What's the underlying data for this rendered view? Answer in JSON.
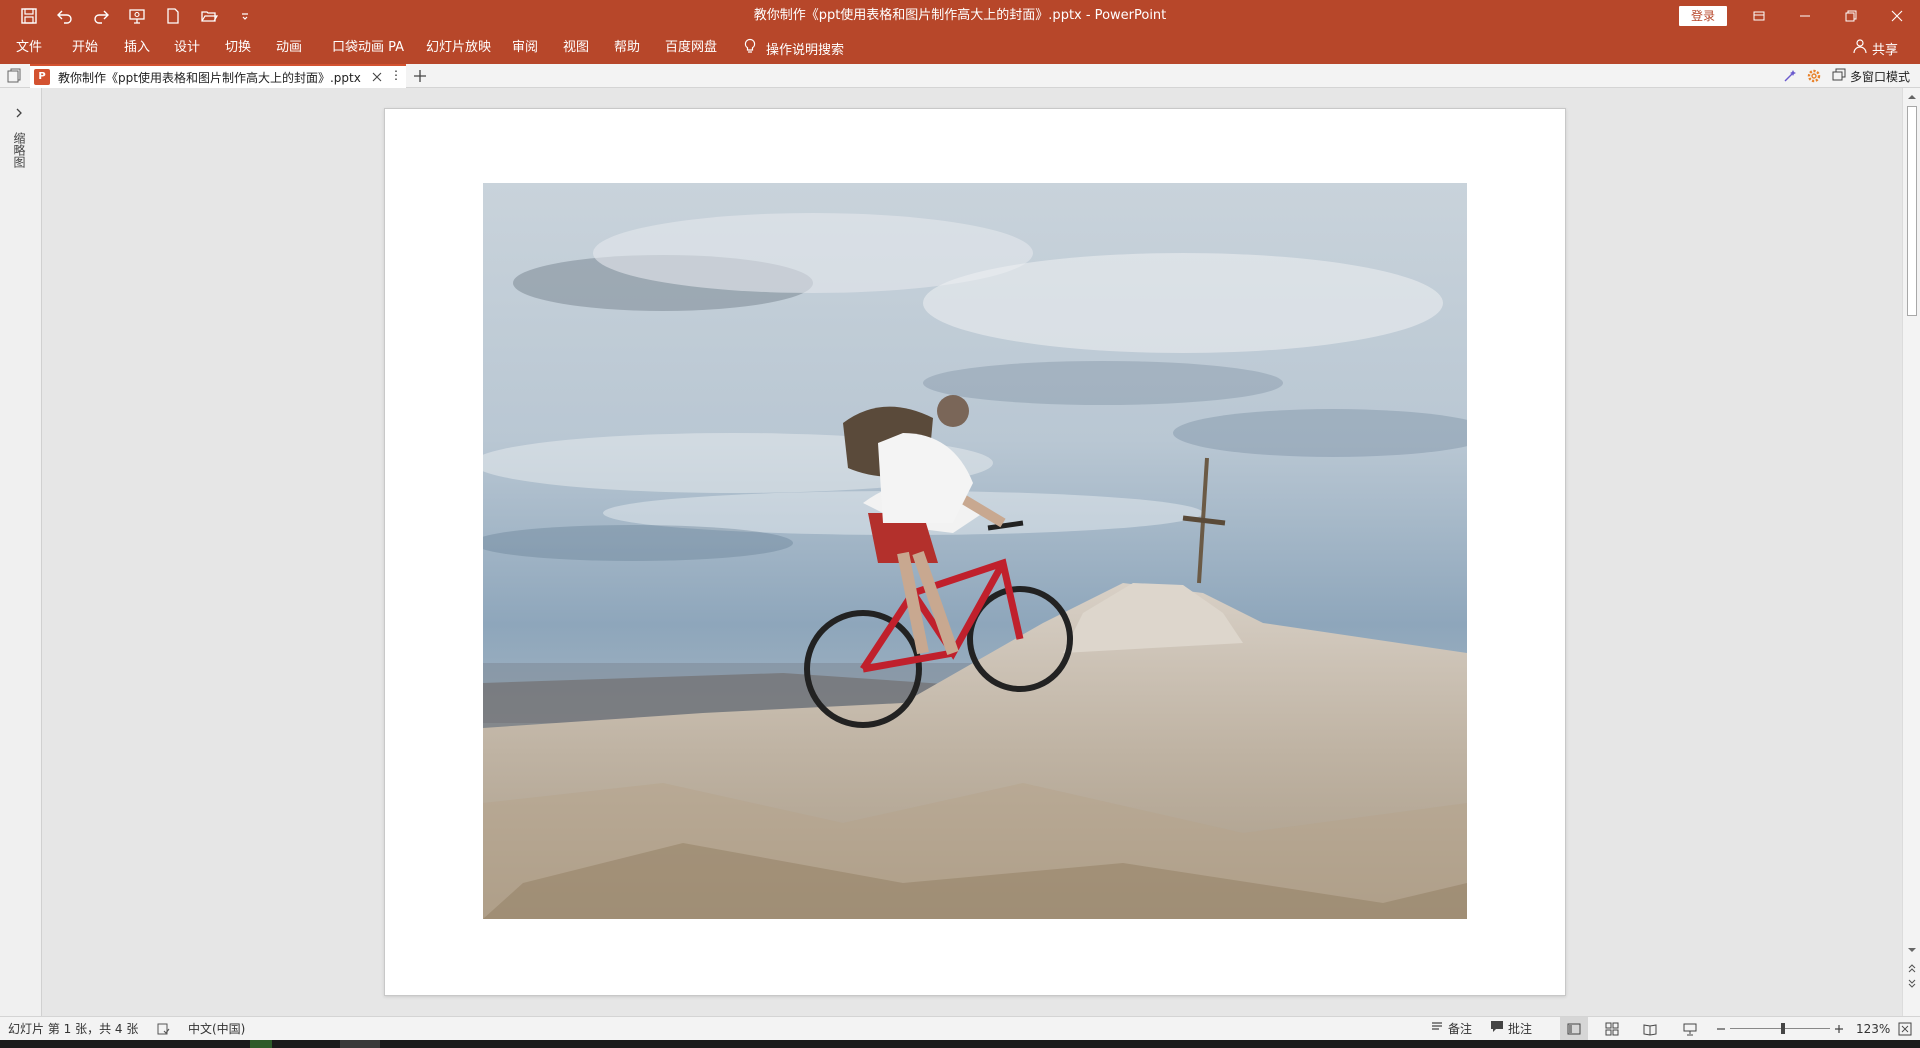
{
  "window": {
    "title": "教你制作《ppt使用表格和图片制作高大上的封面》.pptx  -  PowerPoint",
    "login_label": "登录",
    "accent_color": "#b7472a"
  },
  "quick_access": [
    "save-icon",
    "undo-icon",
    "redo-icon",
    "slideshow-from-start-icon",
    "new-file-icon",
    "open-folder-icon",
    "customize-qat-icon"
  ],
  "ribbon": {
    "tabs": [
      "文件",
      "开始",
      "插入",
      "设计",
      "切换",
      "动画",
      "口袋动画 PA",
      "幻灯片放映",
      "审阅",
      "视图",
      "帮助",
      "百度网盘"
    ],
    "tell_me": "操作说明搜索",
    "share": "共享"
  },
  "document_tab": {
    "name": "教你制作《ppt使用表格和图片制作高大上的封面》.pptx",
    "file_type_badge": "P",
    "multi_window_label": "多窗口模式"
  },
  "left_pane": {
    "label": "缩略图"
  },
  "slide": {
    "image_description_icon": "mountain-cyclist-photo"
  },
  "status_bar": {
    "slide_info": "幻灯片 第 1 张，共 4 张",
    "language": "中文(中国)",
    "notes_label": "备注",
    "comments_label": "批注",
    "zoom": "123%"
  }
}
